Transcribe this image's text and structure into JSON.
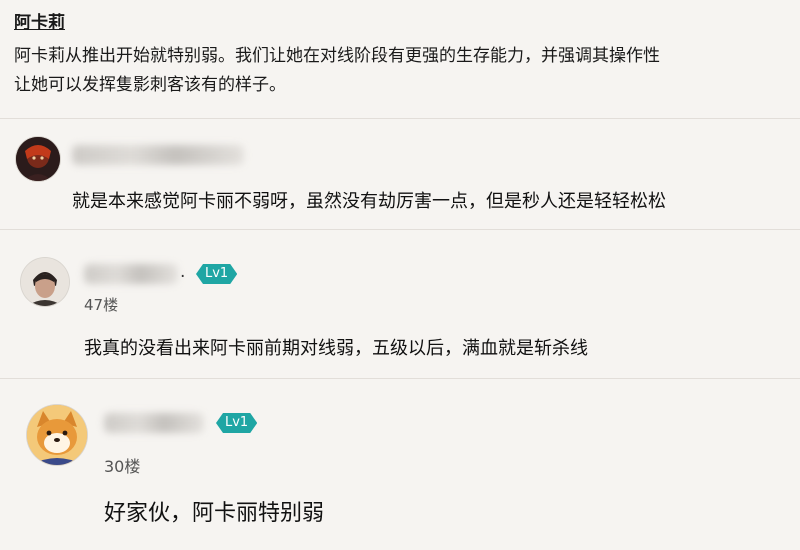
{
  "note": {
    "title": "阿卡莉",
    "line1": "阿卡莉从推出开始就特别弱。我们让她在对线阶段有更强的生存能力，并强调其操作性",
    "line2": "让她可以发挥隻影刺客该有的样子。"
  },
  "comments": [
    {
      "name_tail": "",
      "level": "",
      "floor": "",
      "text": "就是本来感觉阿卡丽不弱呀，虽然没有劫厉害一点，但是秒人还是轻轻松松"
    },
    {
      "name_tail": ".",
      "level": "Lv1",
      "floor": "47楼",
      "text": "我真的没看出来阿卡丽前期对线弱，五级以后，满血就是斩杀线"
    },
    {
      "name_tail": "",
      "level": "Lv1",
      "floor": "30楼",
      "text": "好家伙，阿卡丽特别弱"
    }
  ]
}
